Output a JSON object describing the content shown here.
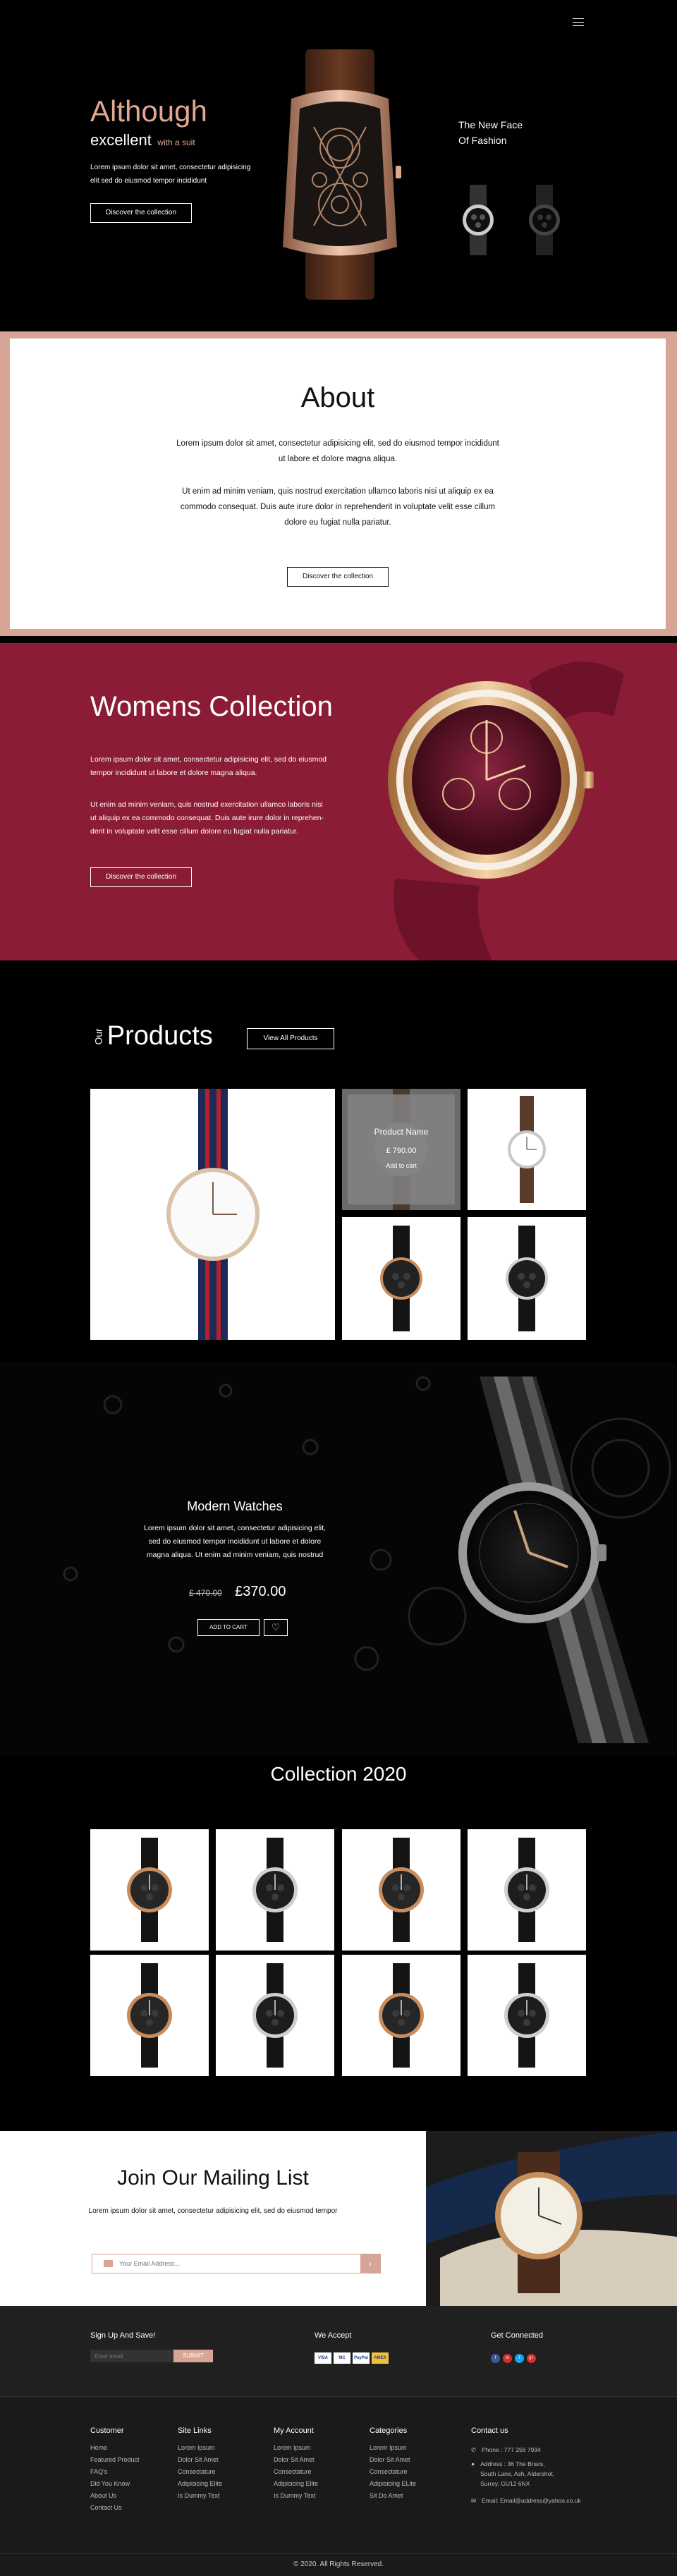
{
  "hero": {
    "title": "Although",
    "subtitle_main": "excellent",
    "subtitle_small": "with a suit",
    "text_line1": "Lorem ipsum dolor sit amet, consectetur adipisicing",
    "text_line2": "elit sed do eiusmod tempor incididunt",
    "cta": "Discover the collection",
    "tagline_line1": "The New Face",
    "tagline_line2": "Of Fashion",
    "menu_icon": "hamburger-menu-icon",
    "accent": "#e0a890"
  },
  "about": {
    "title": "About",
    "p1_line1": "Lorem ipsum dolor sit amet, consectetur adipisicing elit, sed do eiusmod tempor incididunt",
    "p1_line2": "ut labore et dolore magna aliqua.",
    "p2_line1": "Ut enim ad minim veniam, quis nostrud exercitation ullamco laboris nisi ut aliquip ex ea",
    "p2_line2": "commodo consequat. Duis aute irure dolor in reprehenderit in voluptate velit esse cillum",
    "p2_line3": "dolore eu fugiat nulla pariatur.",
    "cta": "Discover the collection",
    "border_color": "#d6a596"
  },
  "womens": {
    "title": "Womens Collection",
    "p1_line1": "Lorem ipsum dolor sit amet, consectetur adipisicing elit, sed do eiusmod",
    "p1_line2": "tempor incididunt ut labore et dolore magna aliqua.",
    "p2_line1": "Ut enim ad minim veniam, quis nostrud exercitation ullamco laboris nisi",
    "p2_line2": "ut aliquip ex ea commodo consequat. Duis aute irure dolor in reprehen-",
    "p2_line3": "derit in voluptate velit esse cillum dolore eu fugiat nulla pariatur.",
    "cta": "Discover the collection",
    "bg": "#8b1c35"
  },
  "products": {
    "our": "Our",
    "title": "Products",
    "view_all": "View All Products",
    "overlay_name": "Product Name",
    "overlay_price": "£ 790.00",
    "overlay_cart": "Add to cart"
  },
  "modern": {
    "title": "Modern Watches",
    "line1": "Lorem ipsum dolor sit amet, consectetur adipisicing elit,",
    "line2": "sed do eiusmod tempor incididunt ut labore et dolore",
    "line3": "magna aliqua. Ut enim ad minim veniam, quis nostrud",
    "old_price": "£ 470.00",
    "price": "£370.00",
    "add_to_cart": "ADD TO CART",
    "heart_icon": "heart-icon"
  },
  "collection": {
    "title": "Collection 2020"
  },
  "mailing": {
    "title": "Join Our Mailing List",
    "text": "Lorem ipsum dolor sit amet, consectetur adipisicing elit, sed do eiusmod tempor",
    "placeholder": "Your Email Address...",
    "submit_icon": "arrow-right-icon",
    "mail_icon": "mail-icon"
  },
  "footer_top": {
    "signup_title": "Sign Up And Save!",
    "signup_placeholder": "Enter email",
    "signup_button": "SUBMIT",
    "accept_title": "We Accept",
    "cards": [
      "VISA",
      "MC",
      "PayPal",
      "AMEX"
    ],
    "connected_title": "Get Connected",
    "socials": [
      "f",
      "in",
      "t",
      "g+"
    ]
  },
  "footer": {
    "columns": [
      {
        "title": "Customer",
        "links": [
          "Home",
          "Featured Product",
          "FAQ's",
          "Did You Know",
          "About Us",
          "Contact Us"
        ]
      },
      {
        "title": "Site Links",
        "links": [
          "Lorem Ipsum",
          "Dolor Sit Amet",
          "Consectature",
          "Adipisicing Elite",
          "Is Dummy Text"
        ]
      },
      {
        "title": "My Account",
        "links": [
          "Lorem Ipsum",
          "Dolor Sit Amet",
          "Consectature",
          "Adipisicing Elite",
          "Is Dummy Text"
        ]
      },
      {
        "title": "Categories",
        "links": [
          "Lorem Ipsum",
          "Dolor Sit Amet",
          "Consectature",
          "Adipisicing ELite",
          "Sit Do Amet"
        ]
      }
    ],
    "contact_title": "Contact us",
    "phone": "Phone : 777 256 7934",
    "address_line1": "Address : 36 The Briars,",
    "address_line2": "South Lane, Ash, Aldershot,",
    "address_line3": "Surrey, GU12 6NX",
    "email": "Email: Email@address@yahoo.co.uk",
    "copyright": "© 2020. All Rights Reserved."
  }
}
